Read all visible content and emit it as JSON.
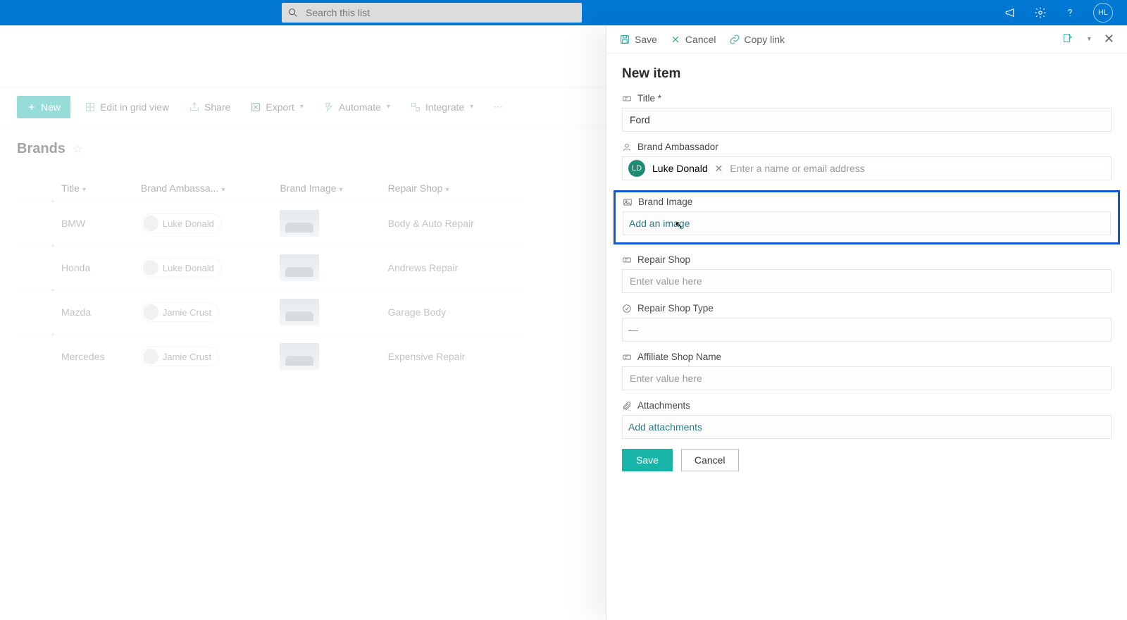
{
  "topbar": {
    "search_placeholder": "Search this list",
    "avatar_initials": "HL"
  },
  "cmdbar": {
    "new": "New",
    "edit_grid": "Edit in grid view",
    "share": "Share",
    "export": "Export",
    "automate": "Automate",
    "integrate": "Integrate"
  },
  "list": {
    "title": "Brands",
    "columns": {
      "title": "Title",
      "ambassador": "Brand Ambassa...",
      "image": "Brand Image",
      "repair": "Repair Shop"
    },
    "rows": [
      {
        "title": "BMW",
        "ambassador": "Luke Donald",
        "repair": "Body & Auto Repair"
      },
      {
        "title": "Honda",
        "ambassador": "Luke Donald",
        "repair": "Andrews Repair"
      },
      {
        "title": "Mazda",
        "ambassador": "Jamie Crust",
        "repair": "Garage Body"
      },
      {
        "title": "Mercedes",
        "ambassador": "Jamie Crust",
        "repair": "Expensive Repair"
      }
    ]
  },
  "panel": {
    "cmd": {
      "save": "Save",
      "cancel": "Cancel",
      "copy": "Copy link"
    },
    "heading": "New item",
    "fields": {
      "title_label": "Title *",
      "title_value": "Ford",
      "ambassador_label": "Brand Ambassador",
      "ambassador_chip": "Luke Donald",
      "ambassador_initials": "LD",
      "ambassador_placeholder": "Enter a name or email address",
      "image_label": "Brand Image",
      "image_link": "Add an image",
      "repair_label": "Repair Shop",
      "repair_placeholder": "Enter value here",
      "repair_type_label": "Repair Shop Type",
      "repair_type_value": "—",
      "affiliate_label": "Affiliate Shop Name",
      "affiliate_placeholder": "Enter value here",
      "attachments_label": "Attachments",
      "attachments_link": "Add attachments"
    },
    "actions": {
      "save": "Save",
      "cancel": "Cancel"
    }
  }
}
